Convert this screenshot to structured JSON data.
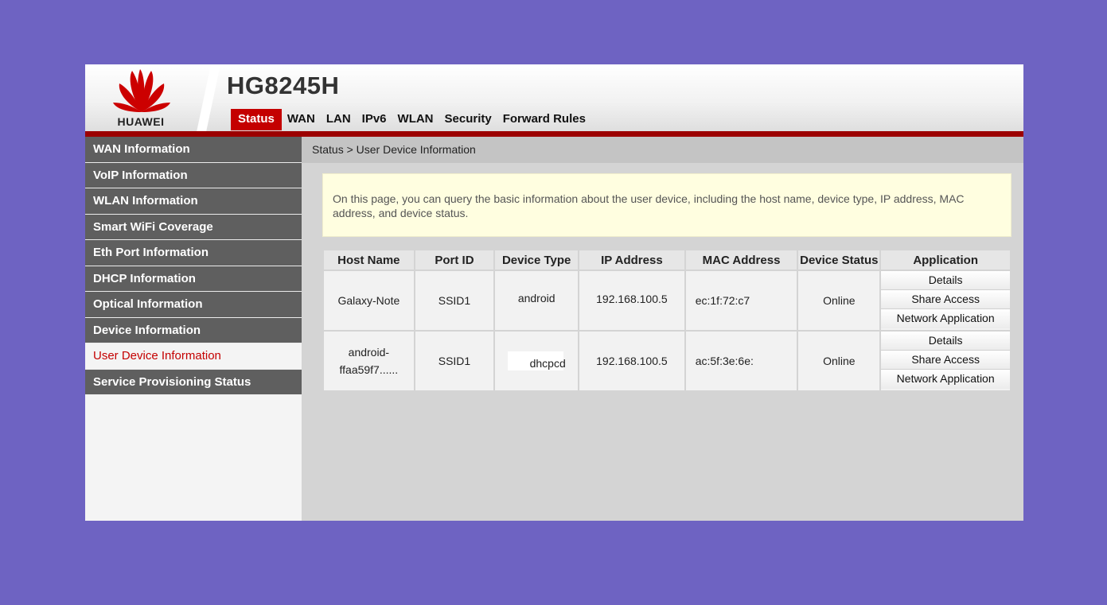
{
  "brand": {
    "logo_text": "HUAWEI",
    "model": "HG8245H"
  },
  "top_tabs": [
    {
      "label": "Status",
      "active": true
    },
    {
      "label": "WAN",
      "active": false
    },
    {
      "label": "LAN",
      "active": false
    },
    {
      "label": "IPv6",
      "active": false
    },
    {
      "label": "WLAN",
      "active": false
    },
    {
      "label": "Security",
      "active": false
    },
    {
      "label": "Forward Rules",
      "active": false
    }
  ],
  "sidebar": {
    "items": [
      {
        "label": "WAN Information",
        "active": false
      },
      {
        "label": "VoIP Information",
        "active": false
      },
      {
        "label": "WLAN Information",
        "active": false
      },
      {
        "label": "Smart WiFi Coverage",
        "active": false
      },
      {
        "label": "Eth Port Information",
        "active": false
      },
      {
        "label": "DHCP Information",
        "active": false
      },
      {
        "label": "Optical Information",
        "active": false
      },
      {
        "label": "Device Information",
        "active": false
      },
      {
        "label": "User Device Information",
        "active": true
      },
      {
        "label": "Service Provisioning Status",
        "active": false
      }
    ]
  },
  "main": {
    "breadcrumb": "Status > User Device Information",
    "info_text": "On this page, you can query the basic information about the user device, including the host name, device type, IP address, MAC address, and device status.",
    "table": {
      "headers": [
        "Host Name",
        "Port ID",
        "Device Type",
        "IP Address",
        "MAC Address",
        "Device Status",
        "Application"
      ],
      "rows": [
        {
          "host_name": "Galaxy-Note",
          "port_id": "SSID1",
          "device_type": "android",
          "ip": "192.168.100.5",
          "mac": "ec:1f:72:c7",
          "status": "Online"
        },
        {
          "host_name_line1": "android-",
          "host_name_line2": "ffaa59f7......",
          "port_id": "SSID1",
          "device_type": "dhcpcd",
          "ip": "192.168.100.5",
          "mac": "ac:5f:3e:6e:",
          "status": "Online"
        }
      ],
      "app_buttons": {
        "details": "Details",
        "share": "Share Access",
        "network": "Network Application"
      }
    }
  },
  "colors": {
    "accent": "#c40000",
    "header_bar": "#9c0000",
    "sidebar_bg": "#5f5f5f",
    "page_bg": "#6e63c2",
    "info_bg": "#fffee0"
  }
}
